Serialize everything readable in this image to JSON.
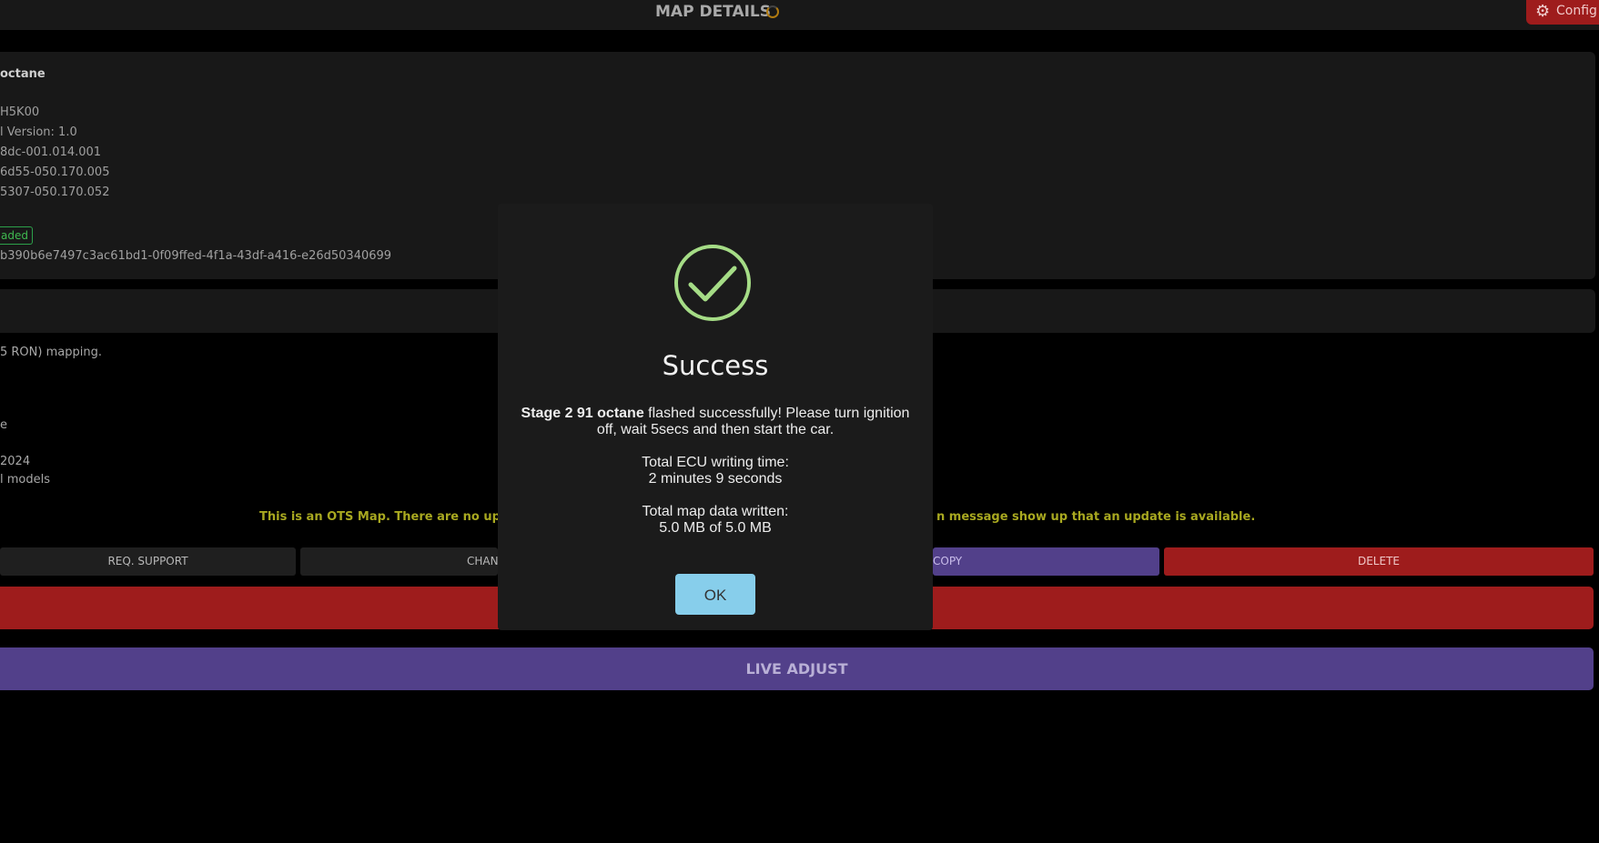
{
  "header": {
    "title": "MAP DETAILS",
    "config_label": "Config"
  },
  "map_card": {
    "heading": "octane",
    "lines": [
      "H5K00",
      "l Version: 1.0",
      "8dc-001.014.001",
      "6d55-050.170.005",
      "5307-050.170.052"
    ],
    "badge": "aded",
    "hash": "b390b6e7497c3ac61bd1-0f09ffed-4f1a-43df-a416-e26d50340699"
  },
  "description": {
    "lines": [
      "5 RON) mapping.",
      "e",
      "2024",
      "l models"
    ]
  },
  "notice": {
    "left": "This is an OTS Map. There are no update",
    "right": "n message show up that an update is available."
  },
  "actions": {
    "req_support": "REQ. SUPPORT",
    "change": "CHAN",
    "copy": "COPY",
    "delete": "DELETE",
    "live_adjust": "LIVE ADJUST"
  },
  "modal": {
    "title": "Success",
    "map_name": "Stage 2 91 octane",
    "message": " flashed successfully! Please turn ignition off, wait 5secs and then start the car.",
    "writing_time_label": "Total ECU writing time:",
    "writing_time_value": "2 minutes 9 seconds",
    "data_written_label": "Total map data written:",
    "data_written_value": "5.0 MB of 5.0 MB",
    "ok_label": "OK"
  },
  "colors": {
    "accent_red": "#9e1c1c",
    "accent_purple": "#52408a",
    "success_green": "#a5dc86",
    "ok_blue": "#87ceeb"
  }
}
